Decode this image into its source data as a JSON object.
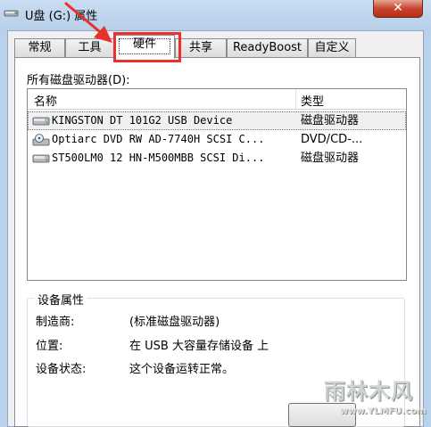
{
  "window": {
    "title": "U盘 (G:) 属性",
    "title_icon": "usb-drive-icon",
    "close_label": "✕"
  },
  "tabs": [
    {
      "label": "常规",
      "active": false
    },
    {
      "label": "工具",
      "active": false
    },
    {
      "label": "硬件",
      "active": true
    },
    {
      "label": "共享",
      "active": false
    },
    {
      "label": "ReadyBoost",
      "active": false
    },
    {
      "label": "自定义",
      "active": false
    }
  ],
  "hardware": {
    "list_label": "所有磁盘驱动器(D):",
    "columns": [
      "名称",
      "类型"
    ],
    "rows": [
      {
        "name": "KINGSTON DT 101G2 USB Device",
        "type": "磁盘驱动器",
        "icon": "disk-drive-icon",
        "selected": true
      },
      {
        "name": "Optiarc DVD RW AD-7740H SCSI C...",
        "type": "DVD/CD-...",
        "icon": "dvd-drive-icon",
        "selected": false
      },
      {
        "name": "ST500LM0 12 HN-M500MBB SCSI Di...",
        "type": "磁盘驱动器",
        "icon": "disk-drive-icon",
        "selected": false
      }
    ]
  },
  "device_properties": {
    "title": "设备属性",
    "fields": [
      {
        "label": "制造商:",
        "value": "(标准磁盘驱动器)"
      },
      {
        "label": "位置:",
        "value": "在 USB 大容量存储设备 上"
      },
      {
        "label": "设备状态:",
        "value": "这个设备运转正常。"
      }
    ]
  },
  "watermark": {
    "text": "雨林木风",
    "url": "www.YLMFU.com"
  },
  "colors": {
    "highlight": "#e8302c",
    "window_frame": "#b9d1ea",
    "panel": "#ffffff"
  }
}
